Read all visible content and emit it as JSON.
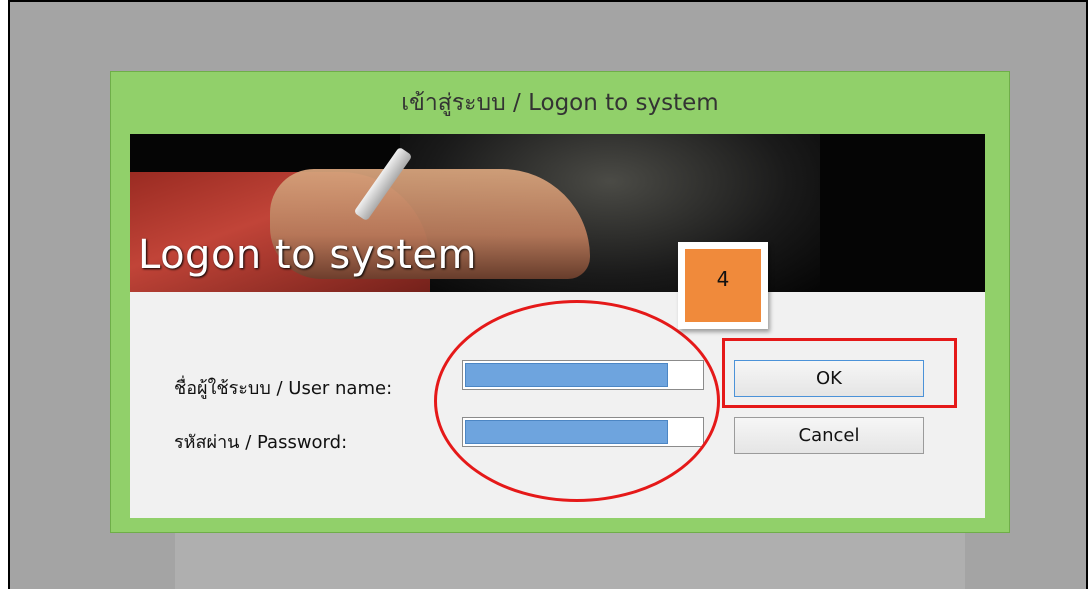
{
  "dialog": {
    "title": "เข้าสู่ระบบ / Logon to system",
    "banner_title": "Logon to system"
  },
  "form": {
    "username_label": "ชื่อผู้ใช้ระบบ / User name:",
    "password_label": "รหัสผ่าน / Password:",
    "username_value": "",
    "password_value": ""
  },
  "buttons": {
    "ok_label": "OK",
    "cancel_label": "Cancel"
  },
  "annotation": {
    "step_number": "4",
    "highlight_color": "#e51919",
    "badge_color": "#f08a3b"
  },
  "colors": {
    "dialog_frame": "#91d06a",
    "selection": "#6ea4de"
  }
}
